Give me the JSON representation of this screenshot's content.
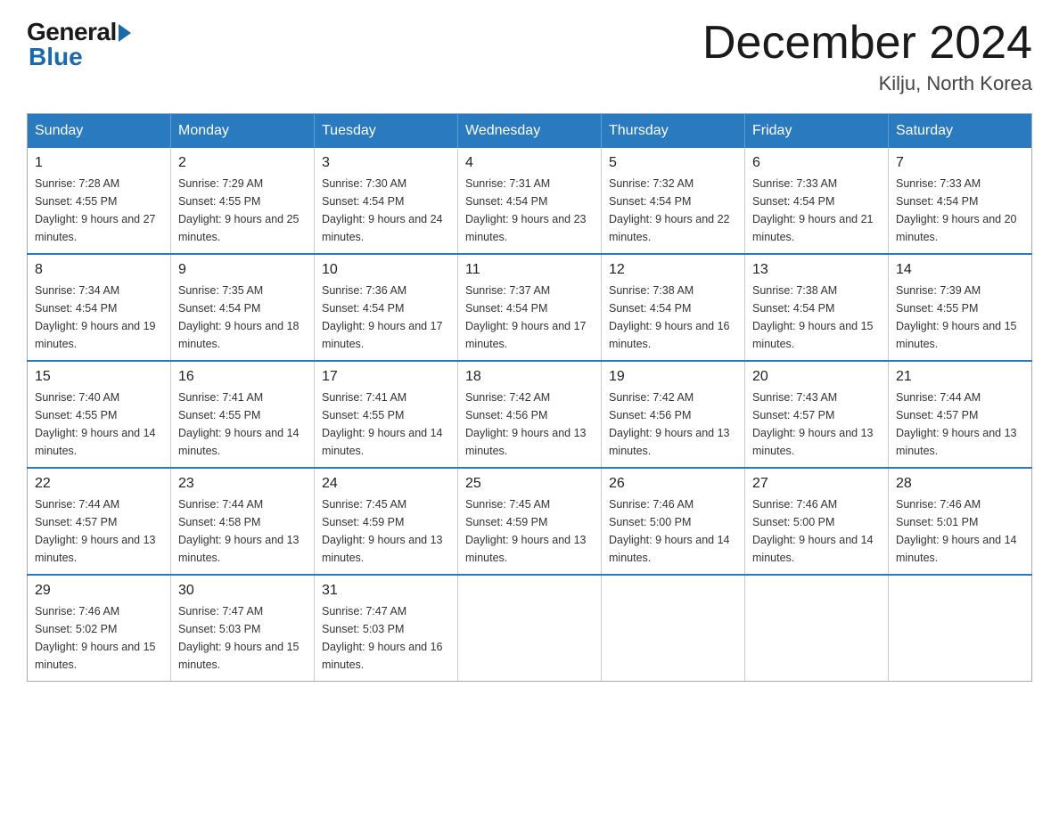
{
  "header": {
    "logo_general": "General",
    "logo_blue": "Blue",
    "title": "December 2024",
    "location": "Kilju, North Korea"
  },
  "weekdays": [
    "Sunday",
    "Monday",
    "Tuesday",
    "Wednesday",
    "Thursday",
    "Friday",
    "Saturday"
  ],
  "weeks": [
    [
      {
        "day": "1",
        "sunrise": "Sunrise: 7:28 AM",
        "sunset": "Sunset: 4:55 PM",
        "daylight": "Daylight: 9 hours and 27 minutes."
      },
      {
        "day": "2",
        "sunrise": "Sunrise: 7:29 AM",
        "sunset": "Sunset: 4:55 PM",
        "daylight": "Daylight: 9 hours and 25 minutes."
      },
      {
        "day": "3",
        "sunrise": "Sunrise: 7:30 AM",
        "sunset": "Sunset: 4:54 PM",
        "daylight": "Daylight: 9 hours and 24 minutes."
      },
      {
        "day": "4",
        "sunrise": "Sunrise: 7:31 AM",
        "sunset": "Sunset: 4:54 PM",
        "daylight": "Daylight: 9 hours and 23 minutes."
      },
      {
        "day": "5",
        "sunrise": "Sunrise: 7:32 AM",
        "sunset": "Sunset: 4:54 PM",
        "daylight": "Daylight: 9 hours and 22 minutes."
      },
      {
        "day": "6",
        "sunrise": "Sunrise: 7:33 AM",
        "sunset": "Sunset: 4:54 PM",
        "daylight": "Daylight: 9 hours and 21 minutes."
      },
      {
        "day": "7",
        "sunrise": "Sunrise: 7:33 AM",
        "sunset": "Sunset: 4:54 PM",
        "daylight": "Daylight: 9 hours and 20 minutes."
      }
    ],
    [
      {
        "day": "8",
        "sunrise": "Sunrise: 7:34 AM",
        "sunset": "Sunset: 4:54 PM",
        "daylight": "Daylight: 9 hours and 19 minutes."
      },
      {
        "day": "9",
        "sunrise": "Sunrise: 7:35 AM",
        "sunset": "Sunset: 4:54 PM",
        "daylight": "Daylight: 9 hours and 18 minutes."
      },
      {
        "day": "10",
        "sunrise": "Sunrise: 7:36 AM",
        "sunset": "Sunset: 4:54 PM",
        "daylight": "Daylight: 9 hours and 17 minutes."
      },
      {
        "day": "11",
        "sunrise": "Sunrise: 7:37 AM",
        "sunset": "Sunset: 4:54 PM",
        "daylight": "Daylight: 9 hours and 17 minutes."
      },
      {
        "day": "12",
        "sunrise": "Sunrise: 7:38 AM",
        "sunset": "Sunset: 4:54 PM",
        "daylight": "Daylight: 9 hours and 16 minutes."
      },
      {
        "day": "13",
        "sunrise": "Sunrise: 7:38 AM",
        "sunset": "Sunset: 4:54 PM",
        "daylight": "Daylight: 9 hours and 15 minutes."
      },
      {
        "day": "14",
        "sunrise": "Sunrise: 7:39 AM",
        "sunset": "Sunset: 4:55 PM",
        "daylight": "Daylight: 9 hours and 15 minutes."
      }
    ],
    [
      {
        "day": "15",
        "sunrise": "Sunrise: 7:40 AM",
        "sunset": "Sunset: 4:55 PM",
        "daylight": "Daylight: 9 hours and 14 minutes."
      },
      {
        "day": "16",
        "sunrise": "Sunrise: 7:41 AM",
        "sunset": "Sunset: 4:55 PM",
        "daylight": "Daylight: 9 hours and 14 minutes."
      },
      {
        "day": "17",
        "sunrise": "Sunrise: 7:41 AM",
        "sunset": "Sunset: 4:55 PM",
        "daylight": "Daylight: 9 hours and 14 minutes."
      },
      {
        "day": "18",
        "sunrise": "Sunrise: 7:42 AM",
        "sunset": "Sunset: 4:56 PM",
        "daylight": "Daylight: 9 hours and 13 minutes."
      },
      {
        "day": "19",
        "sunrise": "Sunrise: 7:42 AM",
        "sunset": "Sunset: 4:56 PM",
        "daylight": "Daylight: 9 hours and 13 minutes."
      },
      {
        "day": "20",
        "sunrise": "Sunrise: 7:43 AM",
        "sunset": "Sunset: 4:57 PM",
        "daylight": "Daylight: 9 hours and 13 minutes."
      },
      {
        "day": "21",
        "sunrise": "Sunrise: 7:44 AM",
        "sunset": "Sunset: 4:57 PM",
        "daylight": "Daylight: 9 hours and 13 minutes."
      }
    ],
    [
      {
        "day": "22",
        "sunrise": "Sunrise: 7:44 AM",
        "sunset": "Sunset: 4:57 PM",
        "daylight": "Daylight: 9 hours and 13 minutes."
      },
      {
        "day": "23",
        "sunrise": "Sunrise: 7:44 AM",
        "sunset": "Sunset: 4:58 PM",
        "daylight": "Daylight: 9 hours and 13 minutes."
      },
      {
        "day": "24",
        "sunrise": "Sunrise: 7:45 AM",
        "sunset": "Sunset: 4:59 PM",
        "daylight": "Daylight: 9 hours and 13 minutes."
      },
      {
        "day": "25",
        "sunrise": "Sunrise: 7:45 AM",
        "sunset": "Sunset: 4:59 PM",
        "daylight": "Daylight: 9 hours and 13 minutes."
      },
      {
        "day": "26",
        "sunrise": "Sunrise: 7:46 AM",
        "sunset": "Sunset: 5:00 PM",
        "daylight": "Daylight: 9 hours and 14 minutes."
      },
      {
        "day": "27",
        "sunrise": "Sunrise: 7:46 AM",
        "sunset": "Sunset: 5:00 PM",
        "daylight": "Daylight: 9 hours and 14 minutes."
      },
      {
        "day": "28",
        "sunrise": "Sunrise: 7:46 AM",
        "sunset": "Sunset: 5:01 PM",
        "daylight": "Daylight: 9 hours and 14 minutes."
      }
    ],
    [
      {
        "day": "29",
        "sunrise": "Sunrise: 7:46 AM",
        "sunset": "Sunset: 5:02 PM",
        "daylight": "Daylight: 9 hours and 15 minutes."
      },
      {
        "day": "30",
        "sunrise": "Sunrise: 7:47 AM",
        "sunset": "Sunset: 5:03 PM",
        "daylight": "Daylight: 9 hours and 15 minutes."
      },
      {
        "day": "31",
        "sunrise": "Sunrise: 7:47 AM",
        "sunset": "Sunset: 5:03 PM",
        "daylight": "Daylight: 9 hours and 16 minutes."
      },
      null,
      null,
      null,
      null
    ]
  ]
}
